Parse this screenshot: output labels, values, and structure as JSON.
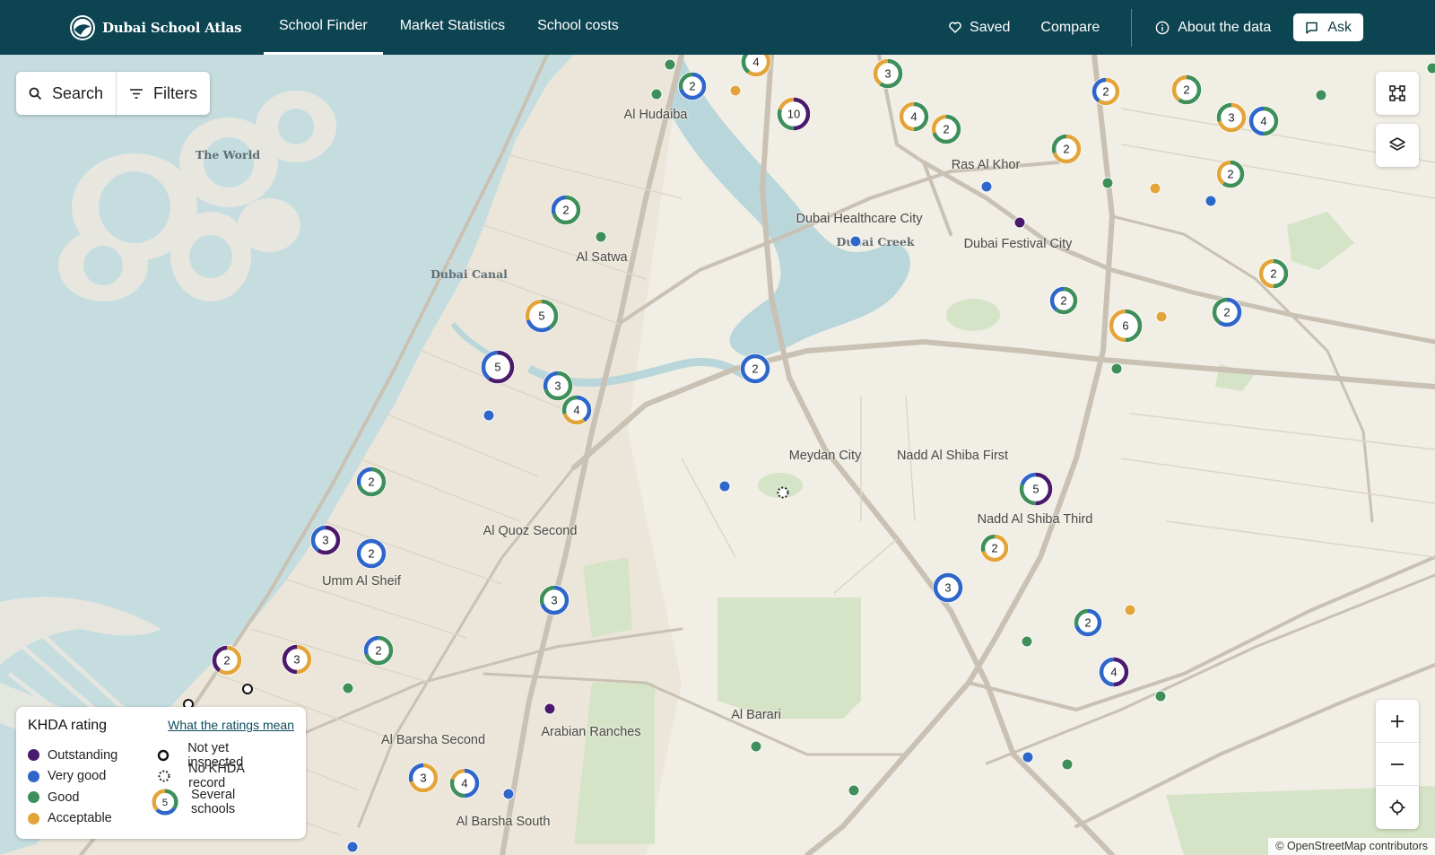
{
  "header": {
    "brand": "Dubai School Atlas",
    "nav": [
      {
        "label": "School Finder",
        "active": true
      },
      {
        "label": "Market Statistics",
        "active": false
      },
      {
        "label": "School costs",
        "active": false
      }
    ],
    "saved": "Saved",
    "compare": "Compare",
    "about": "About the data",
    "ask": "Ask"
  },
  "controls": {
    "search": "Search",
    "filters": "Filters"
  },
  "legend": {
    "title": "KHDA rating",
    "link": "What the ratings mean",
    "ratings": [
      {
        "label": "Outstanding",
        "color": "#4b1a6b"
      },
      {
        "label": "Very good",
        "color": "#2f66c9"
      },
      {
        "label": "Good",
        "color": "#3f8f5a"
      },
      {
        "label": "Acceptable",
        "color": "#e3a53a"
      }
    ],
    "not_inspected": "Not yet inspected",
    "no_record": "No KHDA record",
    "several": "Several schools",
    "several_count": "5"
  },
  "colors": {
    "outstanding": "#4b1a6b",
    "very_good": "#2f66c9",
    "good": "#3f8f5a",
    "acceptable": "#e3a53a",
    "header": "#0d4452"
  },
  "map": {
    "places": [
      "Al Hudaiba",
      "Ras Al Khor",
      "Dubai Healthcare City",
      "Dubai Festival City",
      "Al Satwa",
      "Meydan City",
      "Nadd Al Shiba First",
      "Nadd Al Shiba Third",
      "Al Quoz Second",
      "Umm Al Sheif",
      "Al Barari",
      "Al Barsha Second",
      "Arabian Ranches",
      "Al Barsha South"
    ],
    "water_labels": [
      "The World",
      "Dubai Canal",
      "Dubai Creek"
    ],
    "clusters": [
      "4",
      "2",
      "10",
      "3",
      "4",
      "2",
      "2",
      "2",
      "3",
      "4",
      "2",
      "2",
      "2",
      "5",
      "5",
      "3",
      "4",
      "2",
      "2",
      "2",
      "6",
      "2",
      "5",
      "2",
      "3",
      "2",
      "3",
      "2",
      "3",
      "2",
      "2",
      "3",
      "4",
      "2",
      "3",
      "4",
      "5"
    ]
  },
  "attribution": "© OpenStreetMap contributors"
}
